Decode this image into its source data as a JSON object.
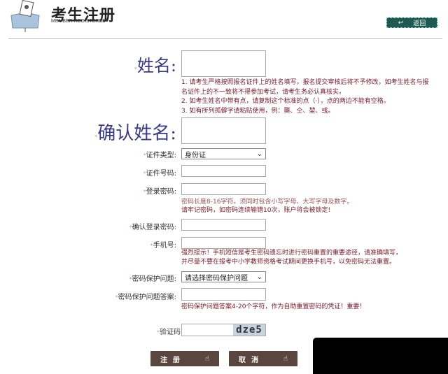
{
  "header": {
    "title": "考生注册",
    "subtitle": "MEMBER REGISTERED",
    "back_label": "返回"
  },
  "form": {
    "name_label": "姓名:",
    "name_notes": [
      "1. 请考生严格按照报名证件上的姓名填写，报名提交审核后将不予修改，如考生姓名与报",
      "名证件上的不一致将不得参加考试，请考生务必认真核实。",
      "2. 如考生姓名中带有点，请复制这个标准的点（·），点的两边不能有空格。",
      "3. 如有所列孤僻字请粘贴使用，例：龑、仝、堃、彧。"
    ],
    "confirm_name_label": "确认姓名:",
    "id_type_label": "证件类型:",
    "id_type_value": "身份证",
    "id_number_label": "证件号码:",
    "password_label": "登录密码:",
    "password_notes": [
      "密码长度8-16字符。须同时包含小写字母、大写字母及数字。",
      "请牢记密码，如密码连续输错10次，账户将会被锁定!"
    ],
    "confirm_password_label": "确认登录密码:",
    "phone_label": "手机号:",
    "phone_notes": [
      "强烈提示！手机短信是考生密码遗忘时进行密码重置的重要途径，请准确填写，",
      "并尽量不要在报考中小学教师资格考试期间更换手机号，以免密码无法重置。"
    ],
    "security_question_label": "密码保护问题:",
    "security_question_value": "请选择密码保护问题",
    "security_answer_label": "密码保护问题答案:",
    "security_answer_note": "密码保护问题答案4-20个字符，作为自助重置密码的凭证！重要！",
    "captcha_label": "验证码",
    "captcha_text": "dze5",
    "star": "*"
  },
  "buttons": {
    "register": "注册",
    "cancel": "取消"
  }
}
